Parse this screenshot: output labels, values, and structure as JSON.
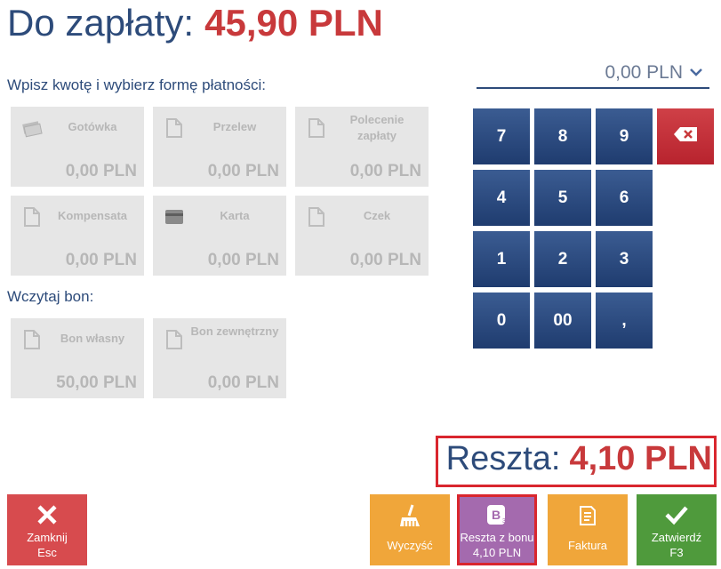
{
  "header": {
    "label": "Do zapłaty:",
    "amount": "45,90 PLN"
  },
  "instructions": "Wpisz kwotę i wybierz formę płatności:",
  "amount_input": {
    "value": "0,00 PLN"
  },
  "payment_methods": [
    {
      "name": "Gotówka",
      "value": "0,00 PLN",
      "icon": "cash-icon"
    },
    {
      "name": "Przelew",
      "value": "0,00 PLN",
      "icon": "document-icon"
    },
    {
      "name": "Polecenie zapłaty",
      "value": "0,00 PLN",
      "icon": "document-icon"
    },
    {
      "name": "Kompensata",
      "value": "0,00 PLN",
      "icon": "document-icon"
    },
    {
      "name": "Karta",
      "value": "0,00 PLN",
      "icon": "card-icon"
    },
    {
      "name": "Czek",
      "value": "0,00 PLN",
      "icon": "document-icon"
    }
  ],
  "voucher_label": "Wczytaj bon:",
  "vouchers": [
    {
      "name": "Bon własny",
      "value": "50,00 PLN",
      "icon": "document-icon"
    },
    {
      "name": "Bon zewnętrzny",
      "value": "0,00 PLN",
      "icon": "document-icon"
    }
  ],
  "keypad": [
    "7",
    "8",
    "9",
    "4",
    "5",
    "6",
    "1",
    "2",
    "3",
    "0",
    "00",
    ","
  ],
  "change": {
    "label": "Reszta:",
    "amount": "4,10 PLN"
  },
  "buttons": {
    "close": {
      "line1": "Zamknij",
      "line2": "Esc"
    },
    "clear": {
      "line1": "Wyczyść"
    },
    "voucher_change": {
      "line1": "Reszta z bonu",
      "line2": "4,10 PLN"
    },
    "invoice": {
      "line1": "Faktura"
    },
    "confirm": {
      "line1": "Zatwierdź",
      "line2": "F3"
    }
  },
  "colors": {
    "navy": "#2d4b7a",
    "red": "#c8393b",
    "orange": "#f0a63a",
    "purple": "#a46aae",
    "green": "#4f9a3c"
  }
}
